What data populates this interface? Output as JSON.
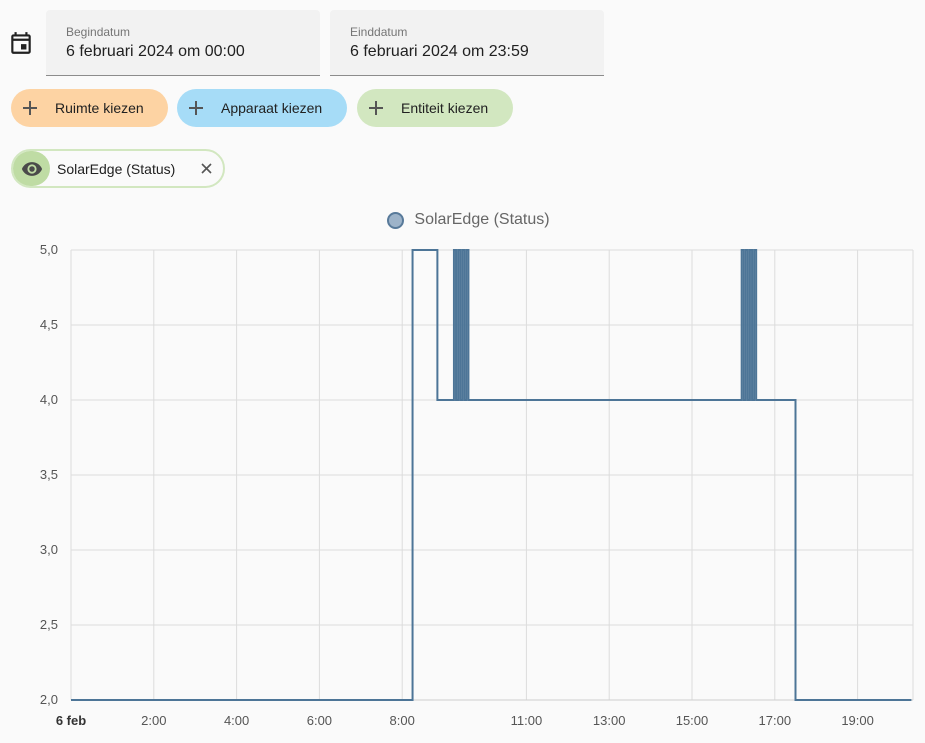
{
  "date_range": {
    "start": {
      "label": "Begindatum",
      "value": "6 februari 2024 om 00:00"
    },
    "end": {
      "label": "Einddatum",
      "value": "6 februari 2024 om 23:59"
    }
  },
  "pickers": {
    "area": {
      "label": "Ruimte kiezen",
      "color": "#fdd3a3"
    },
    "device": {
      "label": "Apparaat kiezen",
      "color": "#a6dcf7"
    },
    "entity": {
      "label": "Entiteit kiezen",
      "color": "#d2e7c0"
    }
  },
  "selected_entity": {
    "label": "SolarEdge (Status)",
    "icon": "eye-icon"
  },
  "icons": {
    "calendar": "calendar-icon",
    "add": "plus-icon",
    "remove": "close-icon"
  },
  "chart_data": {
    "type": "line",
    "step": true,
    "legend": [
      "SolarEdge (Status)"
    ],
    "legend_position": "top-center",
    "series_color": "#4d7597",
    "grid": true,
    "ylim": [
      2.0,
      5.0
    ],
    "xlim": [
      0,
      24
    ],
    "y_ticks": [
      "2,0",
      "2,5",
      "3,0",
      "3,5",
      "4,0",
      "4,5",
      "5,0"
    ],
    "y_tick_values": [
      2.0,
      2.5,
      3.0,
      3.5,
      4.0,
      4.5,
      5.0
    ],
    "x_ticks": [
      "6 feb",
      "2:00",
      "4:00",
      "6:00",
      "8:00",
      "11:00",
      "13:00",
      "15:00",
      "17:00",
      "19:00"
    ],
    "x_tick_hours": [
      0,
      2,
      4,
      6,
      8,
      11,
      13,
      15,
      17,
      19
    ],
    "x_tick_bold": [
      true,
      false,
      false,
      false,
      false,
      false,
      false,
      false,
      false,
      false
    ],
    "series": [
      {
        "name": "SolarEdge (Status)",
        "points": [
          [
            0,
            2
          ],
          [
            8.25,
            5
          ],
          [
            8.85,
            4
          ],
          [
            9.25,
            5
          ],
          [
            9.3,
            4
          ],
          [
            9.35,
            5
          ],
          [
            9.4,
            4
          ],
          [
            9.45,
            5
          ],
          [
            9.5,
            4
          ],
          [
            9.55,
            5
          ],
          [
            9.6,
            4
          ],
          [
            16.2,
            5
          ],
          [
            16.25,
            4
          ],
          [
            16.3,
            5
          ],
          [
            16.35,
            4
          ],
          [
            16.4,
            5
          ],
          [
            16.45,
            4
          ],
          [
            16.5,
            5
          ],
          [
            16.55,
            4
          ],
          [
            17.5,
            2
          ],
          [
            20.3,
            2
          ]
        ]
      }
    ]
  }
}
